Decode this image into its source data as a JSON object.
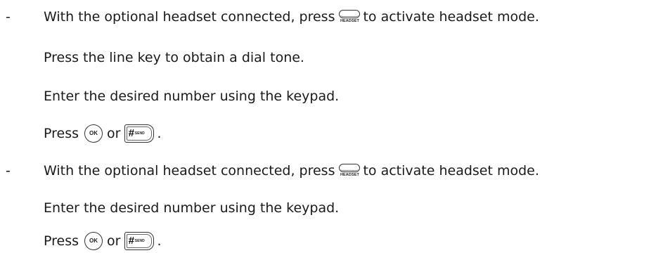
{
  "bullet": "-",
  "keys": {
    "headset_caption": "HEADSET",
    "ok_label": "OK",
    "hash_symbol": "#",
    "send_caption": "SEND"
  },
  "block1": {
    "line1_before": "With the optional headset connected, press",
    "line1_after": "to activate headset mode.",
    "line2": "Press the line key to obtain a dial tone.",
    "line3": "Enter the desired number using the keypad.",
    "line4_press": "Press",
    "line4_or": "or",
    "line4_end": "."
  },
  "block2": {
    "line1_before": "With the optional headset connected, press",
    "line1_after": "to activate headset mode.",
    "line2": "Enter the desired number using the keypad.",
    "line3_press": "Press",
    "line3_or": "or",
    "line3_end": "."
  }
}
